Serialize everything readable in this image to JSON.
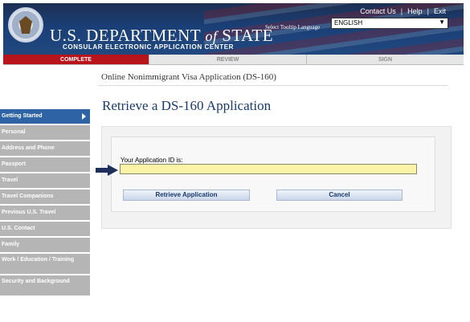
{
  "header": {
    "title_main": "U.S. DEPARTMENT",
    "title_of": "of",
    "title_end": "STATE",
    "subtitle": "CONSULAR ELECTRONIC APPLICATION CENTER",
    "links": [
      "Contact Us",
      "Help",
      "Exit"
    ],
    "tooltip_language_label": "Select Tooltip Language",
    "language_value": "ENGLISH"
  },
  "tabs": [
    "COMPLETE",
    "REVIEW",
    "SIGN"
  ],
  "form_title": "Online Nonimmigrant Visa Application (DS-160)",
  "sidebar": {
    "items": [
      "Getting Started",
      "Personal",
      "Address and Phone",
      "Passport",
      "Travel",
      "Travel Companions",
      "Previous U.S. Travel",
      "U.S. Contact",
      "Family",
      "Work / Education / Training",
      "Security and Background"
    ]
  },
  "main": {
    "heading": "Retrieve a DS-160 Application",
    "app_id_label": "Your Application ID is:",
    "app_id_value": "",
    "retrieve_label": "Retrieve Application",
    "cancel_label": "Cancel"
  },
  "colors": {
    "header_blue": "#1a3f76",
    "tab_complete_red": "#b8141c",
    "sidebar_active": "#2e63a5",
    "input_yellow": "#fbf3a8",
    "heading_blue": "#1a3a6b"
  }
}
